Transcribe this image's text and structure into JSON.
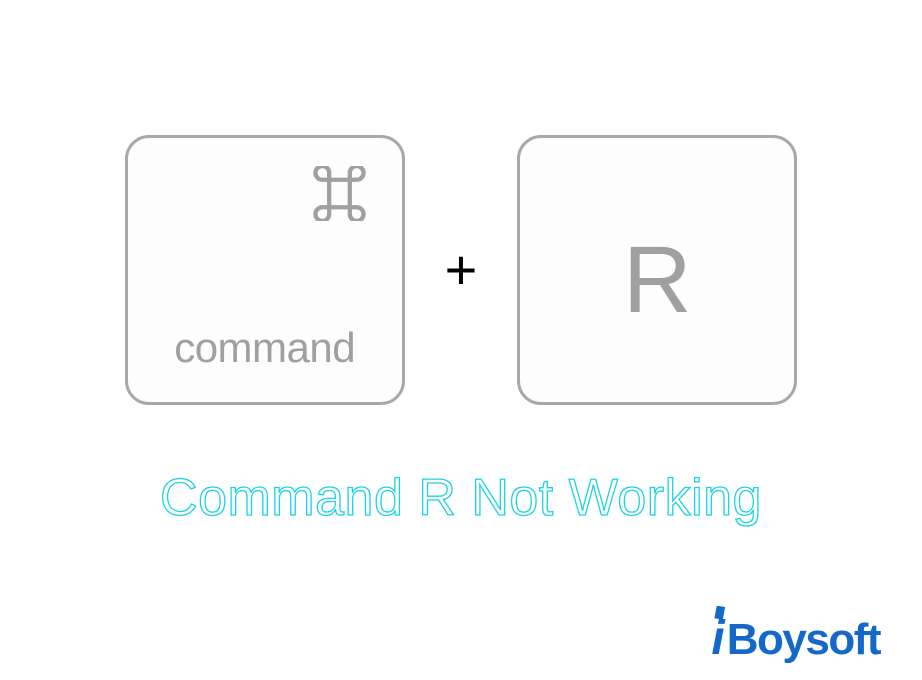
{
  "keys": {
    "command_label": "command",
    "command_icon_name": "command-icon",
    "r_label": "R",
    "plus": "+"
  },
  "headline": "Command R Not Working",
  "brand": {
    "i": "i",
    "rest": "Boysoft"
  },
  "colors": {
    "key_border": "#a8a8a8",
    "key_text": "#a0a0a0",
    "headline_stroke": "#1ed3e0",
    "brand_blue": "#1468c9"
  }
}
